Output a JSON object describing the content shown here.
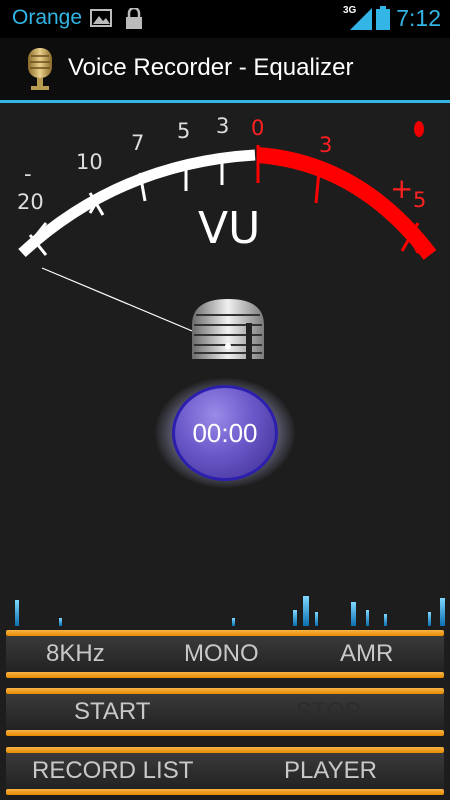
{
  "status_bar": {
    "carrier": "Orange",
    "network": "3G",
    "time": "7:12"
  },
  "action_bar": {
    "title": "Voice Recorder - Equalizer",
    "icon": "microphone-icon"
  },
  "vu_meter": {
    "label": "VU",
    "scale_labels": [
      "-",
      "20",
      "10",
      "7",
      "5",
      "3",
      "0",
      "3",
      "+",
      "5"
    ],
    "needle_icon": "microphone-icon"
  },
  "timer": {
    "value": "00:00"
  },
  "settings_row": {
    "sample_rate": "8KHz",
    "channels": "MONO",
    "format": "AMR"
  },
  "control_row": {
    "start": "START",
    "stop": "STOP"
  },
  "nav_row": {
    "record_list": "RECORD LIST",
    "player": "PLAYER"
  },
  "colors": {
    "accent": "#33b5e5",
    "meter_red": "#ff0000",
    "button_bar": "#f0a020",
    "timer_purple": "#5a48c0"
  }
}
